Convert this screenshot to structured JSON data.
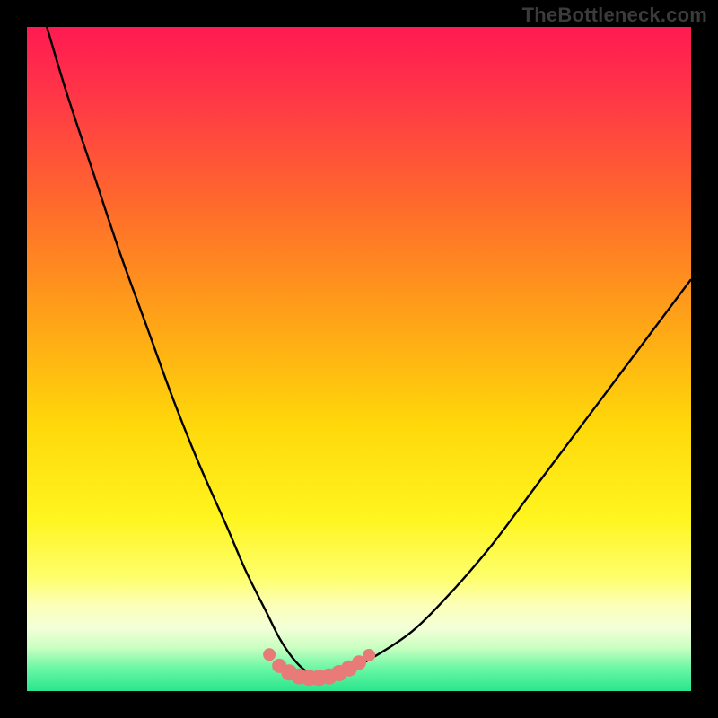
{
  "watermark": "TheBottleneck.com",
  "colors": {
    "background": "#000000",
    "gradient_stops": [
      {
        "pos": 0.0,
        "color": "#ff1a52"
      },
      {
        "pos": 0.12,
        "color": "#ff3b45"
      },
      {
        "pos": 0.28,
        "color": "#ff6e2a"
      },
      {
        "pos": 0.45,
        "color": "#ffa617"
      },
      {
        "pos": 0.6,
        "color": "#ffd80a"
      },
      {
        "pos": 0.74,
        "color": "#fff51f"
      },
      {
        "pos": 0.83,
        "color": "#feff6d"
      },
      {
        "pos": 0.87,
        "color": "#fcffb7"
      },
      {
        "pos": 0.905,
        "color": "#f3ffd8"
      },
      {
        "pos": 0.935,
        "color": "#c9ffc0"
      },
      {
        "pos": 0.965,
        "color": "#6cf7a6"
      },
      {
        "pos": 1.0,
        "color": "#29e58d"
      }
    ],
    "curve": "#000000",
    "marker": "#e87a77"
  },
  "chart_data": {
    "type": "line",
    "title": "",
    "xlabel": "",
    "ylabel": "",
    "xlim": [
      0,
      100
    ],
    "ylim": [
      0,
      100
    ],
    "grid": false,
    "legend": false,
    "series": [
      {
        "name": "bottleneck_curve",
        "x": [
          3,
          6,
          10,
          14,
          18,
          22,
          26,
          30,
          33,
          36,
          38,
          40,
          42,
          44,
          46,
          48,
          52,
          58,
          64,
          70,
          76,
          82,
          88,
          94,
          100
        ],
        "y": [
          100,
          90,
          78,
          66,
          55,
          44,
          34,
          25,
          18,
          12,
          8,
          5,
          3,
          2,
          2,
          3,
          5,
          9,
          15,
          22,
          30,
          38,
          46,
          54,
          62
        ]
      }
    ],
    "markers": {
      "name": "optimal_zone_dots",
      "x": [
        36.5,
        38,
        39.5,
        41,
        42.5,
        44,
        45.5,
        47,
        48.5,
        50,
        51.5
      ],
      "y": [
        5.5,
        3.8,
        2.8,
        2.2,
        2.0,
        2.0,
        2.2,
        2.7,
        3.4,
        4.3,
        5.4
      ],
      "r": [
        7,
        8,
        9,
        9,
        9,
        9,
        9,
        9,
        9,
        8,
        7
      ]
    }
  }
}
